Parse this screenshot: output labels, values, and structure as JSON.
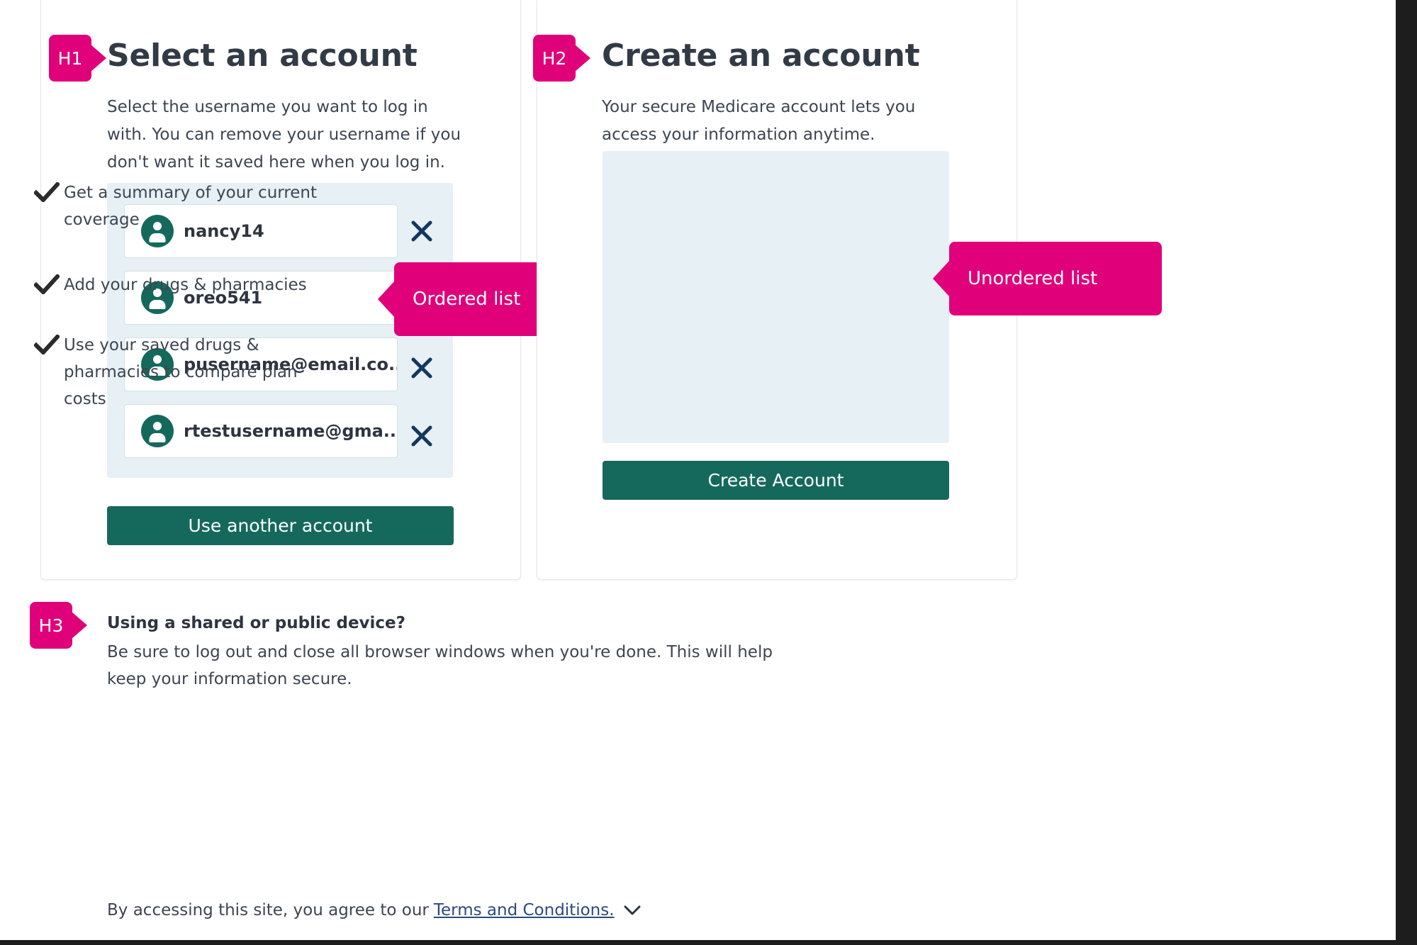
{
  "select_panel": {
    "tag": "H1",
    "heading": "Select an account",
    "description": "Select the username you want to log in with. You can remove your username if you don't want it saved here when you log in.",
    "accounts": [
      {
        "username": "nancy14",
        "avatar_icon": "user-avatar-icon",
        "remove_icon": "close-x-icon",
        "removable": true
      },
      {
        "username": "oreo541",
        "avatar_icon": "user-avatar-icon",
        "remove_icon": "close-x-icon",
        "removable": true
      },
      {
        "username": "pusername@email.co...",
        "avatar_icon": "user-avatar-icon",
        "remove_icon": "close-x-icon",
        "removable": true
      },
      {
        "username": "rtestusername@gma...",
        "avatar_icon": "user-avatar-icon",
        "remove_icon": "close-x-icon",
        "removable": true
      }
    ],
    "use_another_account_label": "Use another account",
    "callout": "Ordered list"
  },
  "create_panel": {
    "tag": "H2",
    "heading": "Create an account",
    "description": "Your secure Medicare account lets you access your information anytime.",
    "benefits": [
      {
        "icon": "check-icon",
        "text": "Get a summary of your current coverage"
      },
      {
        "icon": "check-icon",
        "text": "Add your drugs & pharmacies"
      },
      {
        "icon": "check-icon",
        "text": "Use your saved drugs & pharmacies to compare plan costs"
      }
    ],
    "create_account_label": "Create Account",
    "callout": "Unordered list"
  },
  "shared_device": {
    "tag": "H3",
    "title": "Using a shared or public device?",
    "body": "Be sure to log out and close all browser windows when you're done. This will help keep your information secure.",
    "terms_prefix": "By accessing this site, you agree to our",
    "terms_link": "Terms and Conditions.",
    "chevron_icon": "chevron-down-icon"
  },
  "colors": {
    "accent_pink": "#e0007a",
    "brand_green": "#15695c",
    "panel_blue": "#e7f0f5",
    "link_blue": "#2c4a7c",
    "text_dark": "#323a45"
  }
}
